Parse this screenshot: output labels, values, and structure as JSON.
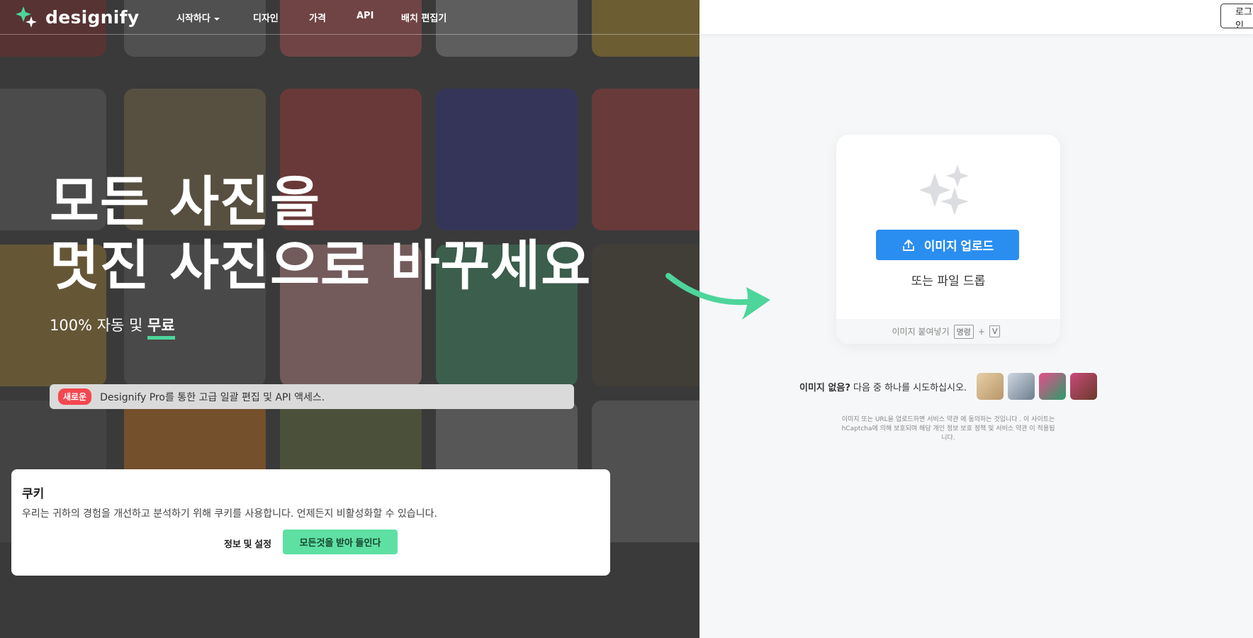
{
  "nav": {
    "logo_text": "designify",
    "links": [
      "시작하다",
      "디자인",
      "가격",
      "API",
      "배치 편집기"
    ],
    "login_label": "로그인"
  },
  "hero": {
    "headline_line1": "모든 사진을",
    "headline_line2": "멋진 사진으로 바꾸세요",
    "sub_prefix": "100% 자동 및 ",
    "sub_highlight": "무료"
  },
  "promo": {
    "badge": "새로운",
    "text": "Designify Pro를 통한 고급 일괄 편집 및 API 액세스."
  },
  "cookie": {
    "title": "쿠키",
    "text": "우리는 귀하의 경험을 개선하고 분석하기 위해 쿠키를 사용합니다. 언제든지 비활성화할 수 있습니다.",
    "settings_label": "정보 및 설정",
    "accept_label": "모든것을 받아 들인다"
  },
  "upload": {
    "button_label": "이미지 업로드",
    "drop_text": "또는 파일 드롭",
    "paste_label": "이미지 붙여넣기",
    "key_command": "명령",
    "key_plus": "+",
    "key_v": "V"
  },
  "samples": {
    "label_bold": "이미지 없음?",
    "label_rest": " 다음 중 하나를 시도하십시오."
  },
  "legal": {
    "text": "이미지 또는 URL을 업로드하면 서비스 약관 에 동의하는 것입니다 . 이 사이트는 hCaptcha에 의해 보호되며 해당 개인 정보 보호 정책 및 서비스 약관 이 적용됩니다."
  },
  "colors": {
    "accent_green": "#4ed59b",
    "upload_blue": "#2a8ef0",
    "badge_red": "#f4474f"
  }
}
